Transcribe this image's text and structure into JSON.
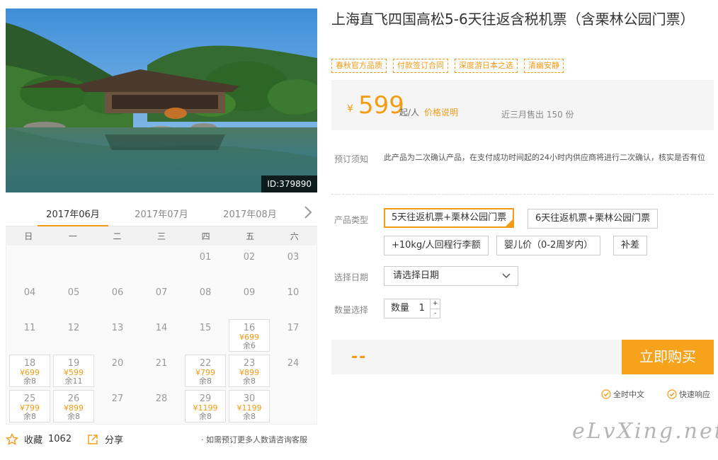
{
  "photo": {
    "id_label": "ID:379890"
  },
  "calendar": {
    "months": [
      "2017年06月",
      "2017年07月",
      "2017年08月"
    ],
    "weekdays": [
      "日",
      "一",
      "二",
      "三",
      "四",
      "五",
      "六"
    ],
    "rows": [
      [
        null,
        null,
        null,
        null,
        {
          "d": "01"
        },
        {
          "d": "02"
        },
        {
          "d": "03"
        }
      ],
      [
        {
          "d": "04"
        },
        {
          "d": "05"
        },
        {
          "d": "06"
        },
        {
          "d": "07"
        },
        {
          "d": "08"
        },
        {
          "d": "09"
        },
        {
          "d": "10"
        }
      ],
      [
        {
          "d": "11"
        },
        {
          "d": "12"
        },
        {
          "d": "13"
        },
        {
          "d": "14"
        },
        {
          "d": "15"
        },
        {
          "d": "16",
          "p": "¥699",
          "r": "余6"
        },
        {
          "d": "17"
        }
      ],
      [
        {
          "d": "18",
          "p": "¥699",
          "r": "余8"
        },
        {
          "d": "19",
          "p": "¥599",
          "r": "余11"
        },
        {
          "d": "20"
        },
        {
          "d": "21"
        },
        {
          "d": "22",
          "p": "¥799",
          "r": "余8"
        },
        {
          "d": "23",
          "p": "¥899",
          "r": "余8"
        },
        {
          "d": "24"
        }
      ],
      [
        {
          "d": "25",
          "p": "¥799",
          "r": "余8"
        },
        {
          "d": "26",
          "p": "¥899",
          "r": "余8"
        },
        {
          "d": "27"
        },
        {
          "d": "28"
        },
        {
          "d": "29",
          "p": "¥1199",
          "r": "余8"
        },
        {
          "d": "30",
          "p": "¥1199",
          "r": "余8"
        },
        null
      ]
    ]
  },
  "footer": {
    "fav_label": "收藏",
    "fav_count": "1062",
    "share_label": "分享",
    "consult": "· 如需预订更多人数请咨询客服"
  },
  "product": {
    "title": "上海直飞四国高松5-6天往返含税机票（含栗林公园门票）",
    "tags": [
      "春秋官方品质",
      "付款签订合同",
      "深度游日本之选",
      "清幽安静"
    ],
    "currency": "¥",
    "price": "599",
    "price_unit": "起/人",
    "price_note": "价格说明",
    "sold": "近三月售出 150 份"
  },
  "notice": {
    "label": "预订须知",
    "text": "此产品为二次确认产品，在支付成功时间起的24小时内供应商将进行二次确认，核实是否有位"
  },
  "options": {
    "type_label": "产品类型",
    "types": [
      "5天往返机票+栗林公园门票",
      "6天往返机票+栗林公园门票",
      "+10kg/人回程行李额",
      "婴儿价（0-2周岁内）",
      "补差"
    ],
    "date_label": "选择日期",
    "date_value": "请选择日期",
    "qty_label": "数量选择",
    "qty_field_label": "数量",
    "qty_value": "1",
    "plus": "+",
    "minus": "-"
  },
  "buy": {
    "total": "--",
    "button": "立即购买"
  },
  "guarantees": [
    "全时中文",
    "快速响应"
  ],
  "watermark": "eLvXing.net",
  "colors": {
    "accent": "#f29b13",
    "button": "#f7a21b"
  }
}
